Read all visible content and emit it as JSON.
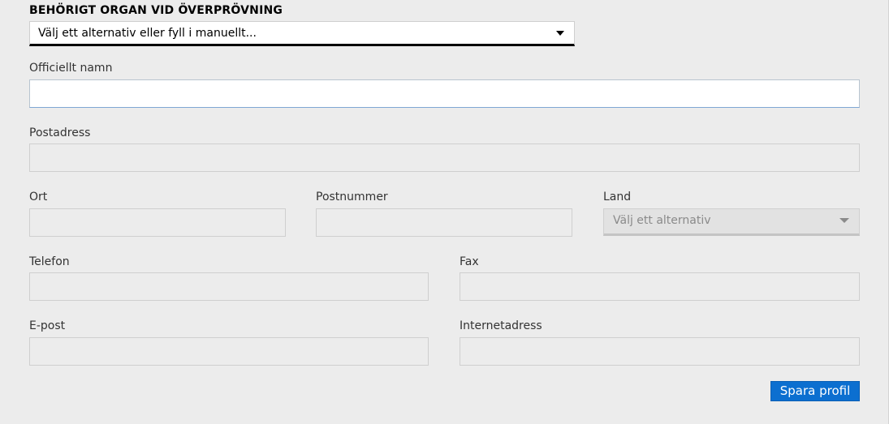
{
  "section": {
    "title": "BEHÖRIGT ORGAN VID ÖVERPRÖVNING"
  },
  "organ_select": {
    "value": "Välj ett alternativ eller fyll i manuellt..."
  },
  "fields": {
    "official_name": {
      "label": "Officiellt namn",
      "value": ""
    },
    "postal_address": {
      "label": "Postadress",
      "value": ""
    },
    "city": {
      "label": "Ort",
      "value": ""
    },
    "postal_code": {
      "label": "Postnummer",
      "value": ""
    },
    "country": {
      "label": "Land",
      "value": "Välj ett alternativ"
    },
    "phone": {
      "label": "Telefon",
      "value": ""
    },
    "fax": {
      "label": "Fax",
      "value": ""
    },
    "email": {
      "label": "E-post",
      "value": ""
    },
    "website": {
      "label": "Internetadress",
      "value": ""
    }
  },
  "actions": {
    "save_label": "Spara profil"
  },
  "colors": {
    "accent": "#0c6fd0",
    "background": "#ececec"
  },
  "icons": {
    "dropdown": "caret-down-icon"
  }
}
